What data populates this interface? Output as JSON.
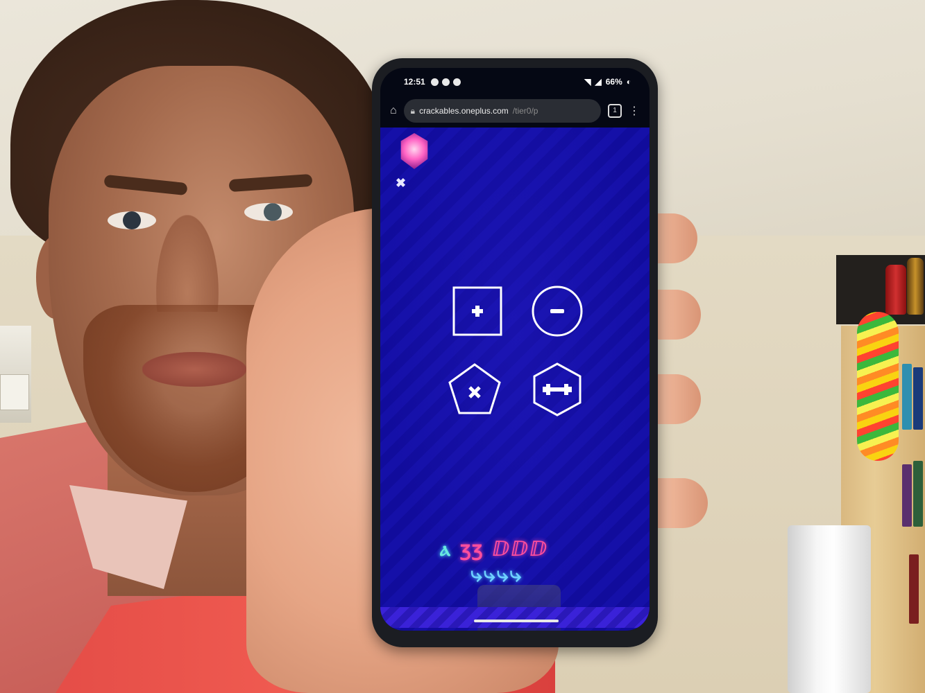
{
  "status_bar": {
    "time": "12:51",
    "battery": "66%"
  },
  "browser": {
    "url_host": "crackables.oneplus.com",
    "url_path": "/tier0/p",
    "tab_count": "1"
  },
  "game": {
    "buttons": [
      {
        "shape": "square",
        "symbol": "+"
      },
      {
        "shape": "circle",
        "symbol": "−"
      },
      {
        "shape": "pentagon",
        "symbol": "×"
      },
      {
        "shape": "hexagon",
        "symbol": "dumbbell"
      }
    ],
    "glyph_colors": {
      "cyan": "#68e8e0",
      "pink": "#ff4f9c",
      "blue": "#6fd0ff",
      "background": "#1510a8"
    }
  }
}
